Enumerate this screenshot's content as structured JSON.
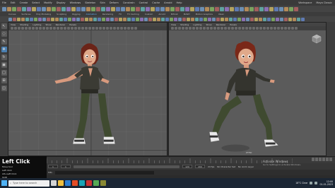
{
  "menubar": {
    "items": [
      "File",
      "Edit",
      "Create",
      "Select",
      "Modify",
      "Display",
      "Windows",
      "Skeleton",
      "Skin",
      "Deform",
      "Constrain",
      "Control",
      "Cache",
      "Arnold",
      "Help"
    ],
    "right_items": [
      "Workspace",
      "Maya Classic"
    ]
  },
  "shelf_tabs": {
    "items": [
      "Curves",
      "Surfaces",
      "Poly Modeling",
      "Sculpting",
      "Rigging",
      "Animation",
      "Rendering",
      "FX",
      "FX Caching",
      "Custom",
      "Arnold",
      "Bifrost",
      "MASH",
      "Motion Graphics",
      "XGen"
    ],
    "active_index": 5
  },
  "viewport_left": {
    "menu": [
      "View",
      "Shading",
      "Lighting",
      "Show",
      "Renderer",
      "Panels"
    ]
  },
  "viewport_right": {
    "menu": [
      "View",
      "Shading",
      "Lighting",
      "Show",
      "Renderer",
      "Panels"
    ],
    "camera_label": "persp"
  },
  "timeline": {
    "start": "1",
    "end": "120",
    "range_start": "1",
    "range_end": "200",
    "fps": "24 fps",
    "char_set": "No Character Set",
    "anim_layer": "No Anim Layer"
  },
  "command_line": {
    "label": "MEL"
  },
  "overlay": {
    "title": "Left Click",
    "lines": [
      "Move tool",
      "Left Click",
      "Alt+Left Click",
      "Shift"
    ]
  },
  "watermark": {
    "title": "Activate Windows",
    "subtitle": "Go to Settings to activate Windows."
  },
  "taskbar": {
    "search_placeholder": "Type here to search",
    "weather": "18°C Clear",
    "time": "12:00",
    "date": "01-01-2023"
  },
  "colors": {
    "viewport_bg": "#5b5b5b",
    "accent": "#5fb5ff",
    "taskbar": "#1b2634"
  }
}
